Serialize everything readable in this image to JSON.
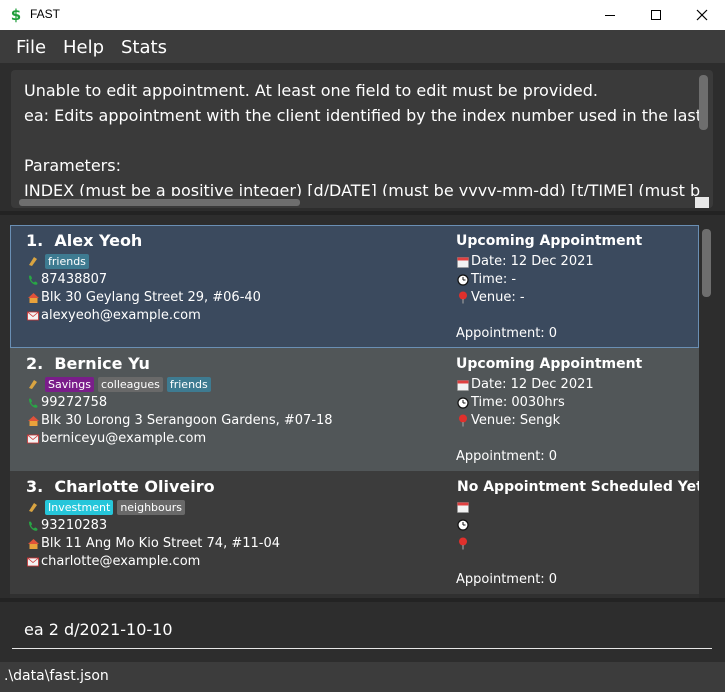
{
  "window": {
    "title": "FAST",
    "app_icon": "$"
  },
  "menu": {
    "file": "File",
    "help": "Help",
    "stats": "Stats"
  },
  "result": {
    "text": "Unable to edit appointment. At least one field to edit must be provided.\nea: Edits appointment with the client identified by the index number used in the last client listing.\n\nParameters:\nINDEX (must be a positive integer) [d/DATE] (must be yyyy-mm-dd) [t/TIME] (must be hh:mm)"
  },
  "clients": [
    {
      "index": "1.",
      "name": "Alex Yeoh",
      "tags": [
        {
          "label": "friends",
          "color": "#3e7b91"
        }
      ],
      "phone": "87438807",
      "address": "Blk 30 Geylang Street 29, #06-40",
      "email": "alexyeoh@example.com",
      "appointment_title": "Upcoming Appointment",
      "date": "Date: 12 Dec 2021",
      "time": "Time: -",
      "venue": "Venue: -",
      "appointment_count": "Appointment: 0"
    },
    {
      "index": "2.",
      "name": "Bernice Yu",
      "tags": [
        {
          "label": "Savings",
          "color": "#7a1d8a"
        },
        {
          "label": "colleagues",
          "color": "#696969"
        },
        {
          "label": "friends",
          "color": "#3e7b91"
        }
      ],
      "phone": "99272758",
      "address": "Blk 30 Lorong 3 Serangoon Gardens, #07-18",
      "email": "berniceyu@example.com",
      "appointment_title": "Upcoming Appointment",
      "date": "Date: 12 Dec 2021",
      "time": "Time: 0030hrs",
      "venue": "Venue: Sengk",
      "appointment_count": "Appointment: 0"
    },
    {
      "index": "3.",
      "name": "Charlotte Oliveiro",
      "tags": [
        {
          "label": "Investment",
          "color": "#26c6da"
        },
        {
          "label": "neighbours",
          "color": "#696969"
        }
      ],
      "phone": "93210283",
      "address": "Blk 11 Ang Mo Kio Street 74, #11-04",
      "email": "charlotte@example.com",
      "appointment_title": "No Appointment Scheduled Yet",
      "date": "",
      "time": "",
      "venue": "",
      "appointment_count": "Appointment: 0"
    }
  ],
  "command": {
    "value": "ea 2 d/2021-10-10"
  },
  "status": {
    "path": ".\\data\\fast.json"
  }
}
